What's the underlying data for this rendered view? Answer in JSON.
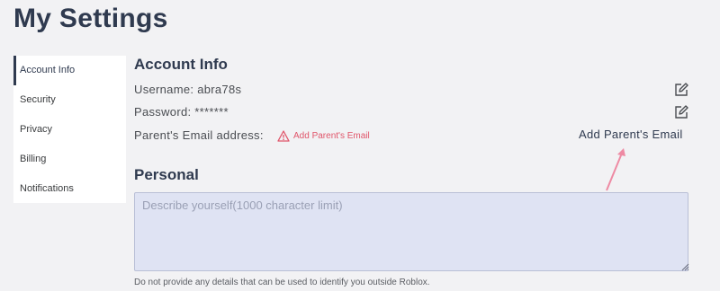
{
  "page": {
    "title": "My Settings"
  },
  "sidebar": {
    "items": [
      {
        "label": "Account Info",
        "active": true
      },
      {
        "label": "Security"
      },
      {
        "label": "Privacy"
      },
      {
        "label": "Billing"
      },
      {
        "label": "Notifications"
      }
    ]
  },
  "account": {
    "section_title": "Account Info",
    "username": "Username: abra78s",
    "password": "Password: *******",
    "parent_email_label": "Parent's Email address:",
    "add_parent_email_warning": "Add Parent's Email",
    "add_parent_email_link": "Add Parent's Email"
  },
  "personal": {
    "section_title": "Personal",
    "placeholder": "Describe yourself(1000 character limit)",
    "hint": "Do not provide any details that can be used to identify you outside Roblox."
  },
  "colors": {
    "accent": "#2f3a4f",
    "warning": "#e0556a",
    "textarea_bg": "#dfe3f3"
  }
}
